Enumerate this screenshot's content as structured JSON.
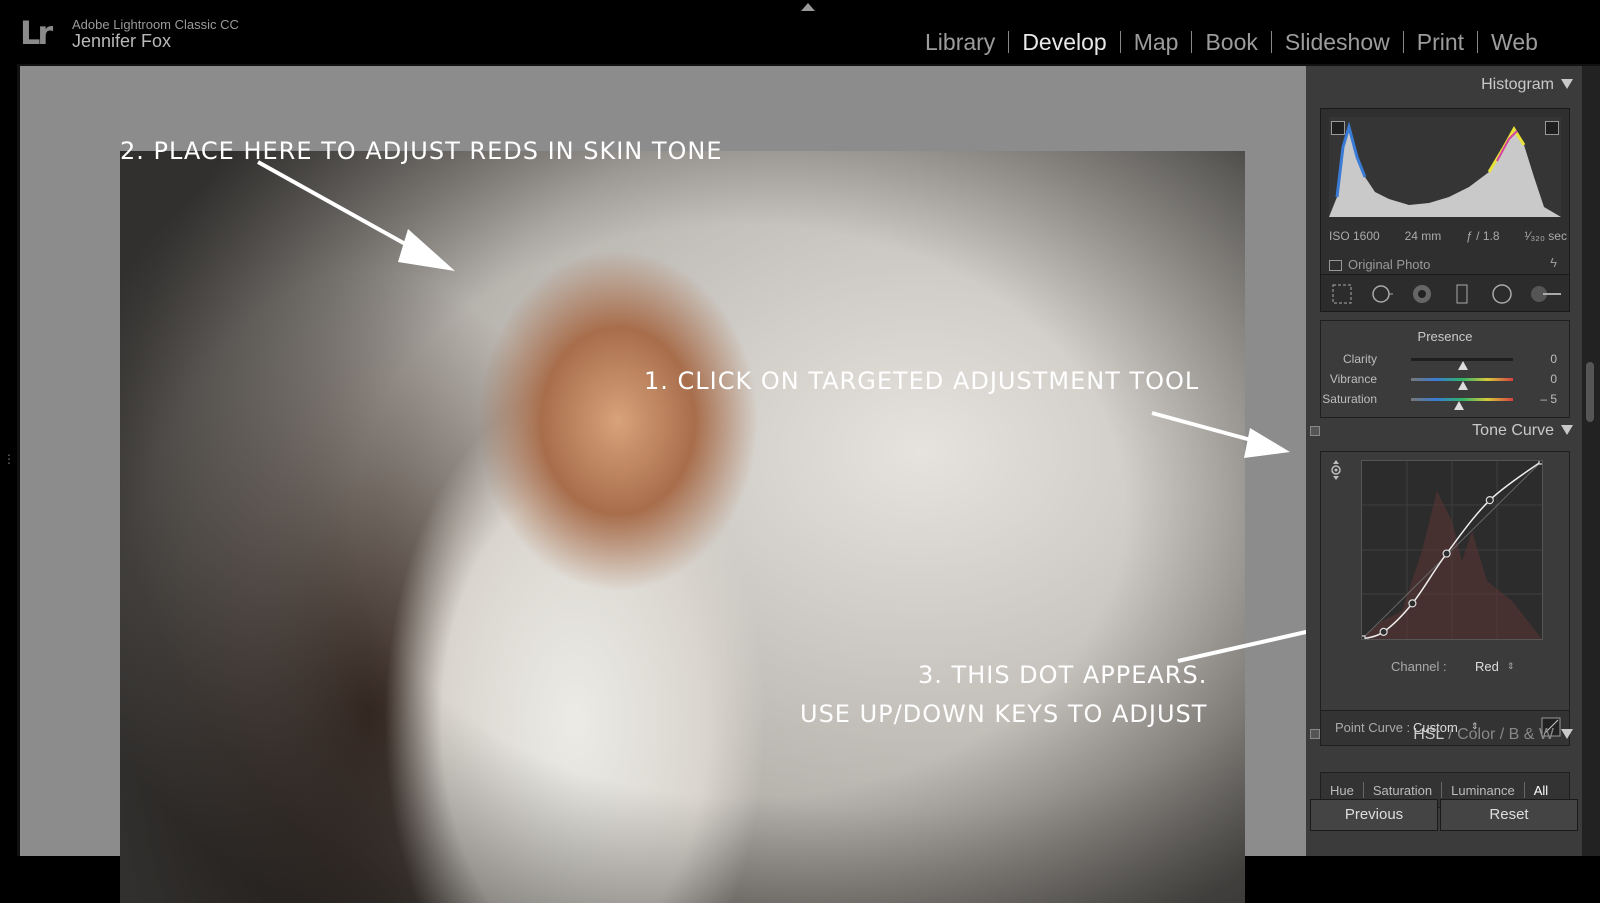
{
  "app": {
    "logo": "Lr",
    "name": "Adobe Lightroom Classic CC",
    "user": "Jennifer Fox"
  },
  "modules": [
    "Library",
    "Develop",
    "Map",
    "Book",
    "Slideshow",
    "Print",
    "Web"
  ],
  "active_module": "Develop",
  "annotations": {
    "step1": "1. CLICK ON TARGETED ADJUSTMENT TOOL",
    "step2": "2. PLACE HERE TO ADJUST REDS IN SKIN TONE",
    "step3_line1": "3. THIS DOT APPEARS.",
    "step3_line2": "USE UP/DOWN KEYS TO ADJUST"
  },
  "histogram": {
    "title": "Histogram",
    "iso": "ISO 1600",
    "focal": "24 mm",
    "aperture": "ƒ / 1.8",
    "shutter": "¹⁄₃₂₀ sec",
    "original_photo": "Original Photo"
  },
  "tools": [
    "grid-crop-icon",
    "spot-removal-icon",
    "red-eye-icon",
    "graduated-filter-icon",
    "radial-filter-icon",
    "adjustment-brush-icon"
  ],
  "presence": {
    "title": "Presence",
    "sliders": [
      {
        "label": "Clarity",
        "value": "0",
        "level": 0
      },
      {
        "label": "Vibrance",
        "value": "0",
        "level": 0
      },
      {
        "label": "Saturation",
        "value": "– 5",
        "level": -5
      }
    ]
  },
  "tone_curve": {
    "title": "Tone Curve",
    "channel_label": "Channel :",
    "channel_value": "Red",
    "point_curve_label": "Point Curve :",
    "point_curve_value": "Custom",
    "curve_points": [
      [
        0,
        0
      ],
      [
        0.12,
        0.04
      ],
      [
        0.28,
        0.2
      ],
      [
        0.47,
        0.48
      ],
      [
        0.71,
        0.78
      ],
      [
        1,
        1
      ]
    ]
  },
  "hsl": {
    "tabs": [
      "HSL",
      "Color",
      "B & W"
    ],
    "subtabs": [
      "Hue",
      "Saturation",
      "Luminance",
      "All"
    ],
    "active_subtab": "All"
  },
  "buttons": {
    "previous": "Previous",
    "reset": "Reset"
  }
}
